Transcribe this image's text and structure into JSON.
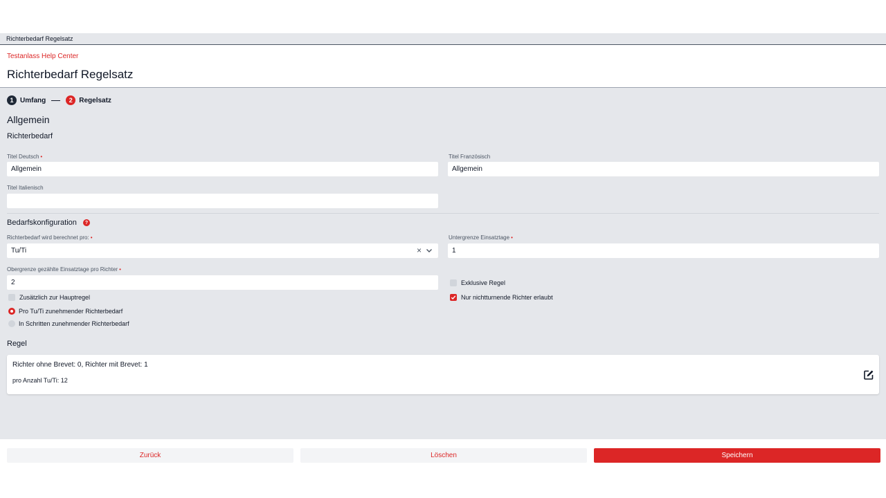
{
  "tabbar": {
    "label": "Richterbedarf Regelsatz"
  },
  "header": {
    "breadcrumb": "Testanlass Help Center",
    "title": "Richterbedarf Regelsatz"
  },
  "stepper": {
    "steps": [
      {
        "number": "1",
        "label": "Umfang",
        "state": "done"
      },
      {
        "number": "2",
        "label": "Regelsatz",
        "state": "active"
      }
    ],
    "separator": "—"
  },
  "section": {
    "title": "Allgemein",
    "subtitle": "Richterbedarf"
  },
  "titles": {
    "de": {
      "label": "Titel Deutsch",
      "value": "Allgemein",
      "required": "•"
    },
    "fr": {
      "label": "Titel Französisch",
      "value": "Allgemein"
    },
    "it": {
      "label": "Titel Italienisch",
      "value": ""
    }
  },
  "config": {
    "title": "Bedarfskonfiguration",
    "help": "?",
    "calc_per": {
      "label": "Richterbedarf wird berechnet pro:",
      "required": "•",
      "value": "Tu/Ti",
      "clear": "×",
      "chevron": "⌄"
    },
    "lower_limit": {
      "label": "Untergrenze Einsatztage",
      "required": "•",
      "value": "1"
    },
    "upper_limit": {
      "label": "Obergrenze gezählte Einsatztage pro Richter",
      "required": "•",
      "value": "2"
    },
    "exclusive": {
      "label": "Exklusive Regel",
      "checked": false
    },
    "additional": {
      "label": "Zusätzlich zur Hauptregel",
      "checked": false
    },
    "non_gymnast_only": {
      "label": "Nur nichtturnende Richter erlaubt",
      "checked": true
    },
    "radio_per": {
      "label": "Pro Tu/Ti zunehmender Richterbedarf",
      "checked": true
    },
    "radio_steps": {
      "label": "In Schritten zunehmender Richterbedarf",
      "checked": false
    }
  },
  "rule": {
    "title": "Regel",
    "line1": "Richter ohne Brevet: 0, Richter mit Brevet: 1",
    "line2": "pro Anzahl Tu/Ti: 12",
    "edit_icon": "edit-icon"
  },
  "footer": {
    "back": "Zurück",
    "delete": "Löschen",
    "save": "Speichern"
  },
  "colors": {
    "accent": "#dc2626",
    "background": "#e5e7eb",
    "dark": "#1f2937"
  }
}
